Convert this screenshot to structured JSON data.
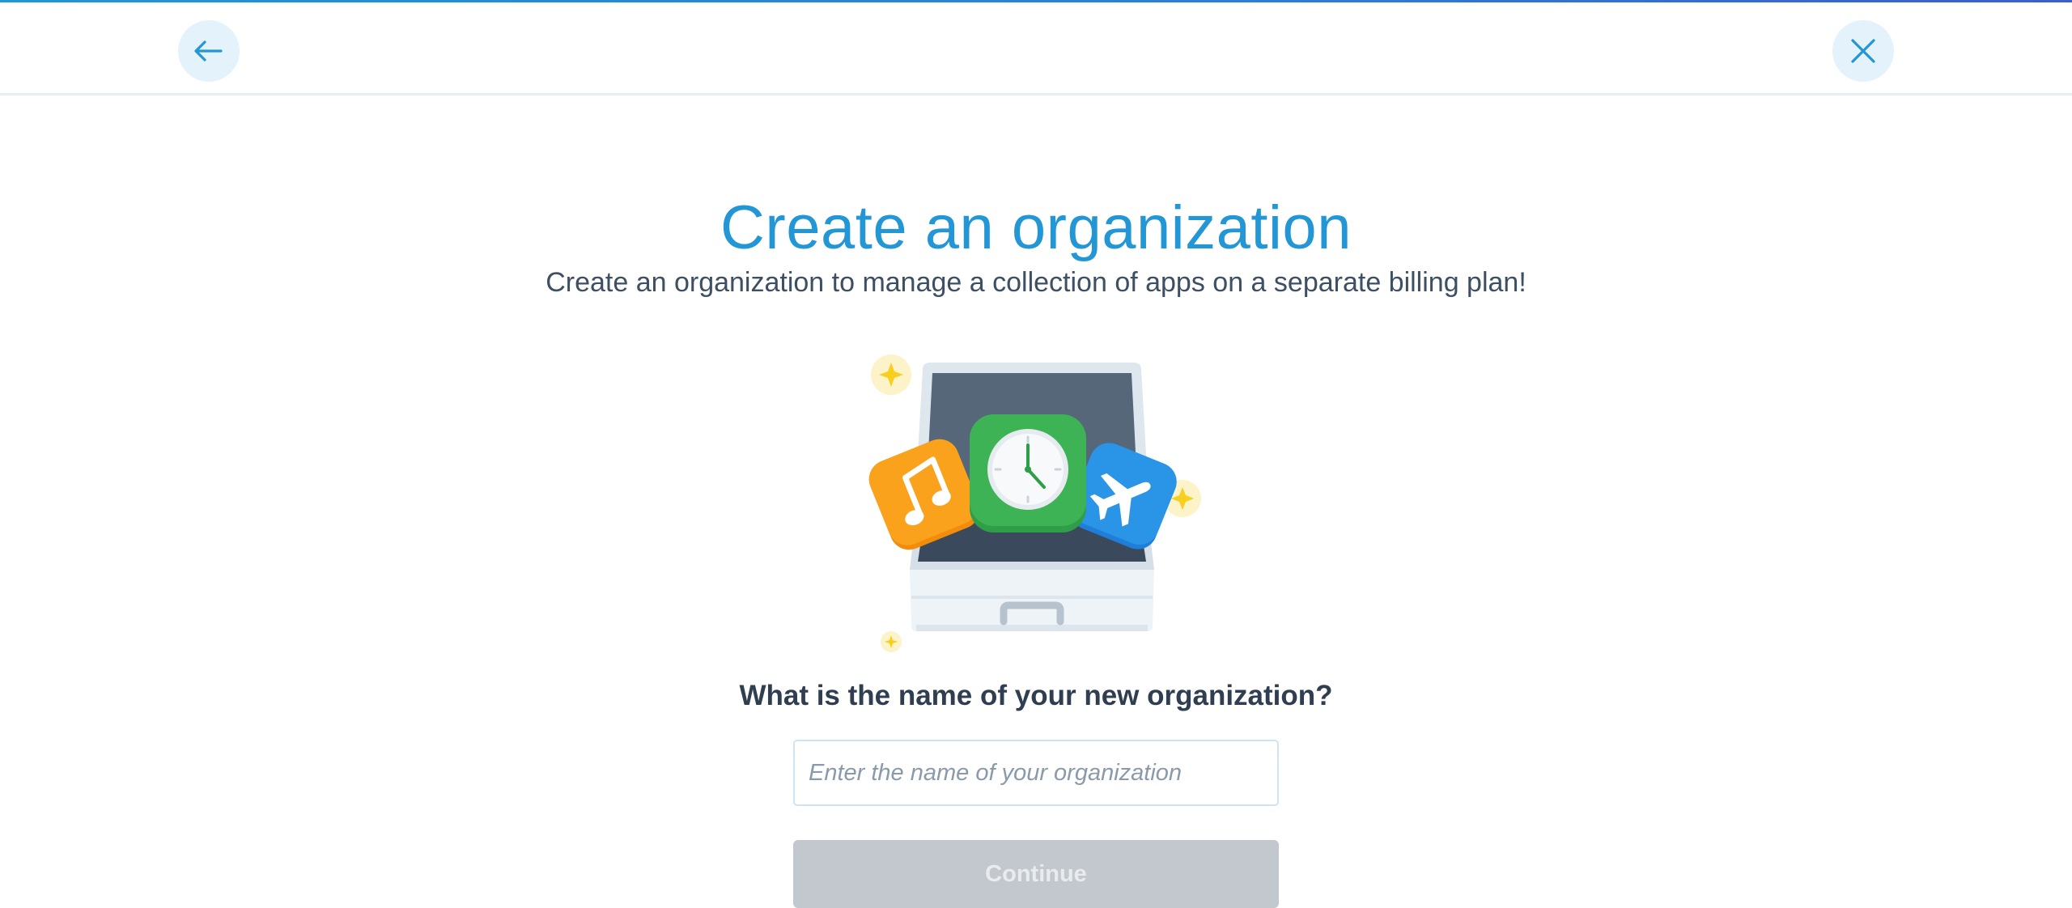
{
  "header": {
    "back_icon": "arrow-left-icon",
    "close_icon": "close-icon",
    "accent_color": "#1e96d8"
  },
  "main": {
    "title": "Create an organization",
    "subtitle": "Create an organization to manage a collection of apps on a separate billing plan!",
    "illustration_icons": [
      "briefcase-icon",
      "music-note-icon",
      "clock-icon",
      "airplane-icon",
      "sparkle-icon"
    ],
    "question": "What is the name of your new organization?",
    "name_input": {
      "value": "",
      "placeholder": "Enter the name of your organization"
    },
    "continue_label": "Continue"
  },
  "colors": {
    "title": "#2396d6",
    "text": "#3d4f63",
    "button_disabled": "#c3c8cf",
    "icon_circle": "#e4f2fb"
  }
}
